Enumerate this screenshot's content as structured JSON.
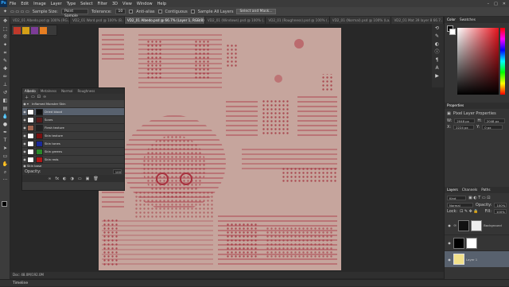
{
  "menu": [
    "File",
    "Edit",
    "Image",
    "Layer",
    "Type",
    "Select",
    "Filter",
    "3D",
    "View",
    "Window",
    "Help"
  ],
  "options": {
    "sample_size_label": "Sample Size:",
    "sample_size_value": "Point Sample",
    "tolerance_label": "Tolerance:",
    "tolerance_value": "10",
    "anti_alias": "Anti-alias",
    "contiguous": "Contiguous",
    "sample_all": "Sample All Layers",
    "select_mask": "Select and Mask..."
  },
  "tabs": [
    "VD2_01 Albedo.psd @ 100% (RG...",
    "VD2_01 Word.psd @ 100% (B...",
    "VD2_01 Albedo.psd @ 66.7% (Layer 1, RGB/8) *",
    "VD2_01 (Windows).psd @ 100% (...",
    "VD2_01 (Roughness).psd @ 100% (...",
    "VD2_01 (Normal).psd @ 100% (La...",
    "VD2_01 Mat 39 layer 8 66.7..."
  ],
  "float_panel": {
    "tabs": [
      "Albedo",
      "Metalness",
      "Normal",
      "Roughness"
    ],
    "group": "Inflamed Monster Skin",
    "layers": [
      "Dried blood",
      "Scars",
      "Flesh texture",
      "Skin texture",
      "Skin tones",
      "Skin greens",
      "Skin reds",
      "Skin base"
    ],
    "opacity_label": "Opacity:",
    "opacity_value": "100"
  },
  "right": {
    "color_tabs": [
      "Color",
      "Swatches"
    ],
    "properties_title": "Properties",
    "properties_sub": "Pixel Layer Properties",
    "w_label": "W:",
    "w_value": "2048 px",
    "h_label": "H:",
    "h_value": "2048 px",
    "x_label": "X:",
    "x_value": "2224 px",
    "y_label": "Y:",
    "y_value": "0 px",
    "layers_tabs": [
      "Layers",
      "Channels",
      "Paths"
    ],
    "kind_label": "Kind",
    "blend_mode": "Normal",
    "opacity_label": "Opacity:",
    "opacity_value": "100%",
    "lock_label": "Lock:",
    "fill_label": "Fill:",
    "fill_value": "100%",
    "layer_items": [
      "Background",
      "Layer 1"
    ]
  },
  "status": "Doc: 48.0M/192.0M",
  "timeline_label": "Timeline",
  "colors": {
    "accent": "#31a8ff",
    "fg_swatch": "#000000",
    "bg_swatch": "#ffffff",
    "canvas_base": "#c9a49c",
    "pattern": "#a8323f"
  }
}
